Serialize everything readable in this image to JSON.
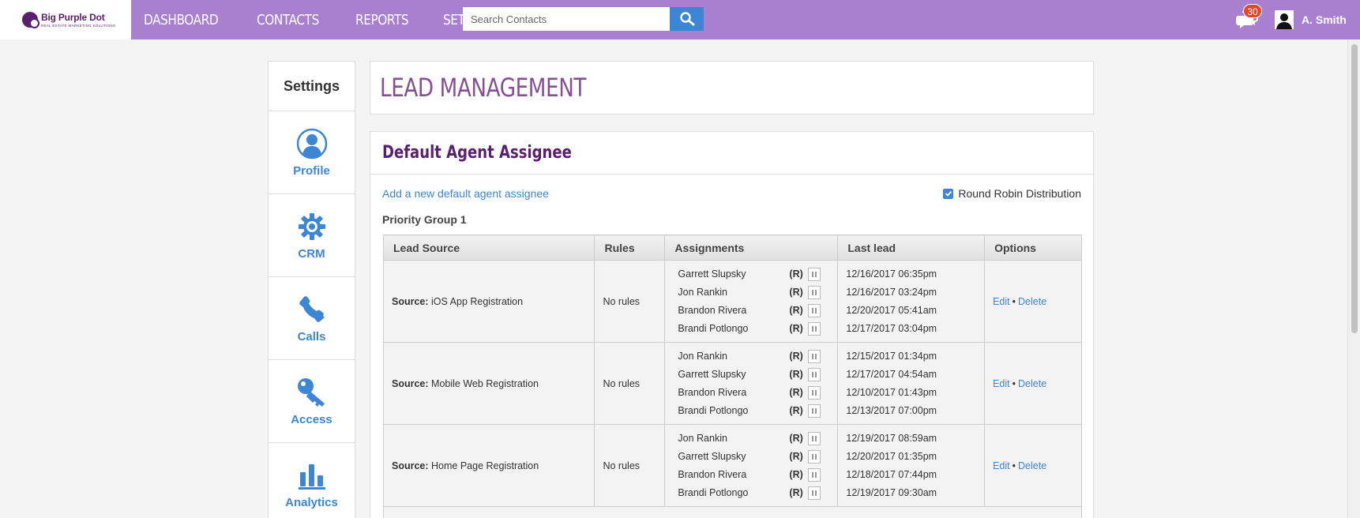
{
  "brand": {
    "name": "Big Purple Dot",
    "tagline": "REAL ESTATE MARKETING SOLUTIONS"
  },
  "nav": {
    "items": [
      "DASHBOARD",
      "CONTACTS",
      "REPORTS",
      "SETTINGS"
    ]
  },
  "search": {
    "placeholder": "Search Contacts",
    "value": ""
  },
  "notifications": {
    "count": "30"
  },
  "user": {
    "name": "A. Smith"
  },
  "sidebar": {
    "title": "Settings",
    "items": [
      {
        "label": "Profile",
        "icon": "user-circle-icon"
      },
      {
        "label": "CRM",
        "icon": "gear-icon"
      },
      {
        "label": "Calls",
        "icon": "phone-icon"
      },
      {
        "label": "Access",
        "icon": "key-icon"
      },
      {
        "label": "Analytics",
        "icon": "bar-chart-icon"
      }
    ]
  },
  "page": {
    "title": "LEAD MANAGEMENT"
  },
  "section": {
    "title": "Default Agent Assignee",
    "add_link": "Add a new default agent assignee",
    "round_robin_label": "Round Robin Distribution",
    "round_robin_checked": true,
    "group_label": "Priority Group 1"
  },
  "table": {
    "headers": [
      "Lead Source",
      "Rules",
      "Assignments",
      "Last lead",
      "Options"
    ],
    "source_prefix": "Source:",
    "edit_label": "Edit",
    "separator": "•",
    "delete_label": "Delete",
    "r_marker": "(R)",
    "rows": [
      {
        "source": "iOS App Registration",
        "rules": "No rules",
        "assignments": [
          {
            "name": "Garrett Slupsky",
            "last": "12/16/2017 06:35pm"
          },
          {
            "name": "Jon Rankin",
            "last": "12/16/2017 03:24pm"
          },
          {
            "name": "Brandon Rivera",
            "last": "12/20/2017 05:41am"
          },
          {
            "name": "Brandi Potlongo",
            "last": "12/17/2017 03:04pm"
          }
        ]
      },
      {
        "source": "Mobile Web Registration",
        "rules": "No rules",
        "assignments": [
          {
            "name": "Jon Rankin",
            "last": "12/15/2017 01:34pm"
          },
          {
            "name": "Garrett Slupsky",
            "last": "12/17/2017 04:54am"
          },
          {
            "name": "Brandon Rivera",
            "last": "12/10/2017 01:43pm"
          },
          {
            "name": "Brandi Potlongo",
            "last": "12/13/2017 07:00pm"
          }
        ]
      },
      {
        "source": "Home Page Registration",
        "rules": "No rules",
        "assignments": [
          {
            "name": "Jon Rankin",
            "last": "12/19/2017 08:59am"
          },
          {
            "name": "Garrett Slupsky",
            "last": "12/20/2017 01:35pm"
          },
          {
            "name": "Brandon Rivera",
            "last": "12/18/2017 07:44pm"
          },
          {
            "name": "Brandi Potlongo",
            "last": "12/19/2017 09:30am"
          }
        ]
      }
    ]
  },
  "colors": {
    "header": "#a97fcf",
    "brand_dark": "#5a1f6e",
    "link": "#3d86d6",
    "badge": "#e8432c"
  }
}
